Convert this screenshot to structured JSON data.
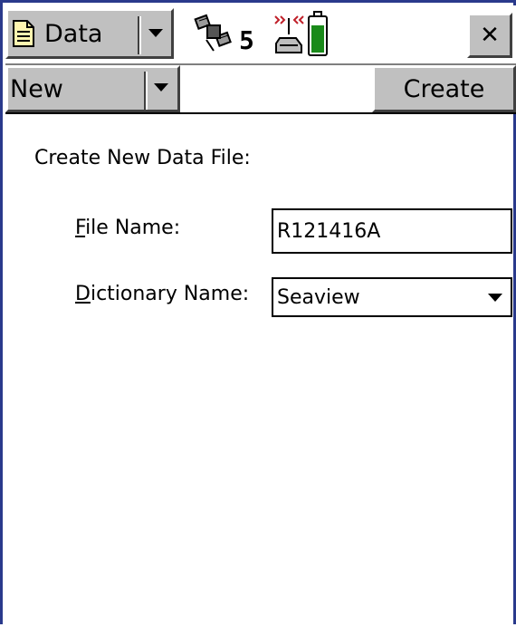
{
  "app_menu": {
    "label": "Data",
    "icon": "document-icon"
  },
  "status": {
    "satellite_count": "5",
    "satellite_icon": "satellite-icon",
    "antenna_icon": "gps-receiver-icon",
    "battery_icon": "battery-icon",
    "battery_level": 0.8
  },
  "close_label": "✕",
  "toolbar": {
    "mode_value": "New",
    "create_label": "Create"
  },
  "form": {
    "heading": "Create New Data File:",
    "file_name_label": {
      "mnemonic": "F",
      "rest": "ile Name:"
    },
    "file_name_value": "R121416A",
    "dictionary_label": {
      "mnemonic": "D",
      "rest": "ictionary Name:"
    },
    "dictionary_value": "Seaview"
  },
  "colors": {
    "frame": "#2a3a8c",
    "button_face": "#c0c0c0",
    "battery_fill": "#1a8a1a"
  }
}
